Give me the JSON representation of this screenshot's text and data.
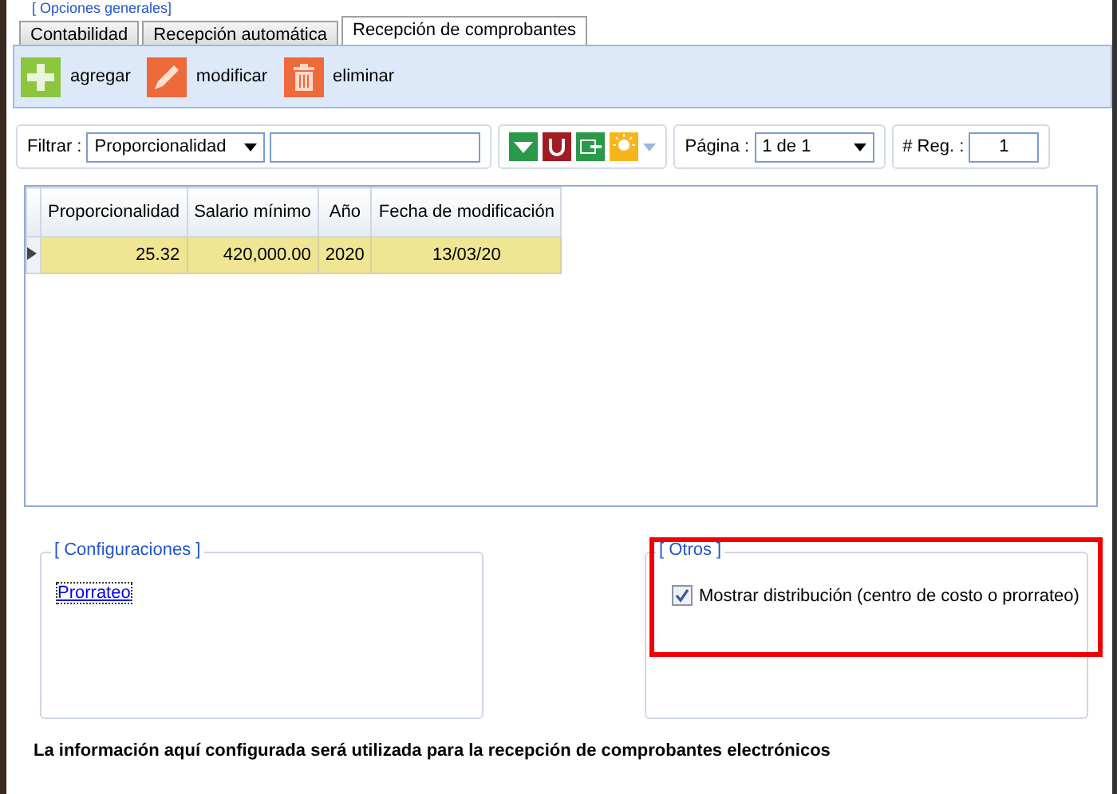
{
  "section_title": "[ Opciones generales]",
  "tabs": [
    {
      "label": "Contabilidad",
      "selected": false
    },
    {
      "label": "Recepción automática",
      "selected": false
    },
    {
      "label": "Recepción de comprobantes",
      "selected": true
    }
  ],
  "toolbar": [
    {
      "kind": "add",
      "label": "agregar"
    },
    {
      "kind": "edit",
      "label": "modificar"
    },
    {
      "kind": "delete",
      "label": "eliminar"
    }
  ],
  "filter": {
    "label": "Filtrar :",
    "field": "Proporcionalidad"
  },
  "pager": {
    "label": "Página :",
    "value": "1 de 1",
    "records_label": "# Reg. :",
    "records": "1"
  },
  "table": {
    "columns": [
      "Proporcionalidad",
      "Salario mínimo",
      "Año",
      "Fecha de modificación"
    ],
    "rows": [
      {
        "selected": true,
        "cells": [
          "25.32",
          "420,000.00",
          "2020",
          "13/03/20"
        ]
      }
    ]
  },
  "configuraciones": {
    "title": "[ Configuraciones ]",
    "links": [
      "Prorrateo"
    ]
  },
  "otros": {
    "title": "[ Otros ]",
    "options": [
      {
        "label": "Mostrar distribución (centro de costo o prorrateo)",
        "checked": true
      }
    ]
  },
  "footer": "La información aquí configurada será utilizada para la recepción de comprobantes electrónicos"
}
